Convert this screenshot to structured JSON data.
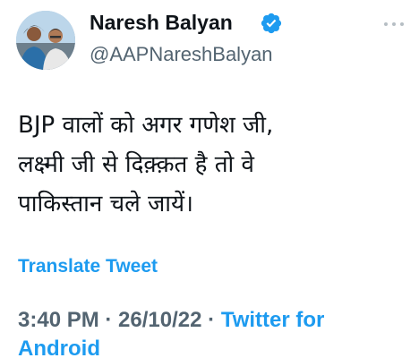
{
  "author": {
    "name": "Naresh Balyan",
    "handle": "@AAPNareshBalyan",
    "verified": true
  },
  "tweet": {
    "lines": [
      "BJP वालों को अगर गणेश जी,",
      "लक्ष्मी जी से दिक़्क़त है तो वे",
      "पाकिस्तान चले जायें।"
    ]
  },
  "translate_label": "Translate Tweet",
  "meta": {
    "time": "3:40 PM",
    "separator": "·",
    "date": "26/10/22",
    "source": "Twitter for Android"
  },
  "colors": {
    "accent": "#1d9bf0",
    "secondary_text": "#536471",
    "primary_text": "#0f1419"
  },
  "icons": [
    "avatar",
    "verified-badge-icon",
    "more-options-icon"
  ]
}
